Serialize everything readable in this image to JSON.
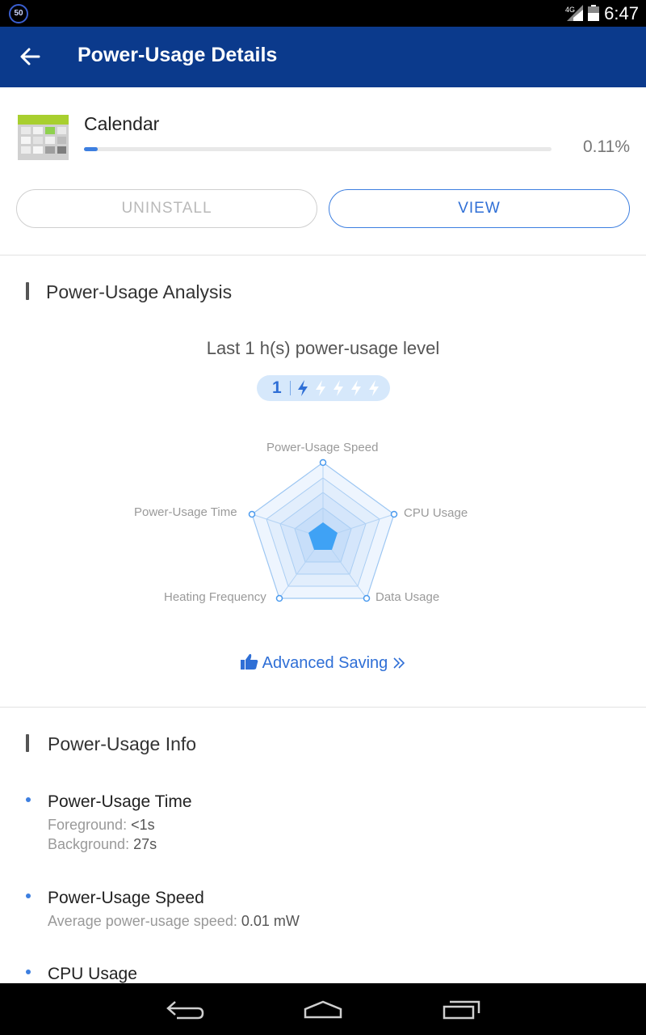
{
  "status_bar": {
    "notification_badge": "50",
    "network": "4G",
    "time": "6:47"
  },
  "app_bar": {
    "title": "Power-Usage Details"
  },
  "app": {
    "name": "Calendar",
    "percent": "0.11%",
    "usage_fraction": 0.0011
  },
  "buttons": {
    "uninstall": "UNINSTALL",
    "view": "VIEW"
  },
  "analysis": {
    "title": "Power-Usage Analysis",
    "level_caption": "Last 1 h(s) power-usage level",
    "level": "1",
    "level_max": 5,
    "radar_labels": {
      "speed": "Power-Usage Speed",
      "cpu": "CPU Usage",
      "data": "Data Usage",
      "heating": "Heating Frequency",
      "time": "Power-Usage Time"
    },
    "advanced_saving": "Advanced Saving"
  },
  "info": {
    "title": "Power-Usage Info",
    "items": [
      {
        "title": "Power-Usage Time",
        "lines": [
          {
            "label": "Foreground",
            "value": "<1s"
          },
          {
            "label": "Background",
            "value": "27s"
          }
        ]
      },
      {
        "title": "Power-Usage Speed",
        "lines": [
          {
            "label": "Average power-usage speed",
            "value": "0.01 mW"
          }
        ]
      },
      {
        "title": "CPU Usage",
        "lines": []
      }
    ]
  },
  "colors": {
    "app_bar": "#0b3a8c",
    "accent": "#2f6fd6",
    "status_bar": "#000000"
  }
}
